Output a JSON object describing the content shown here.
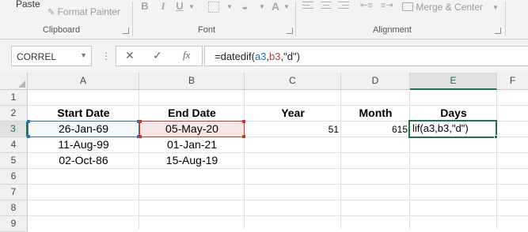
{
  "ribbon": {
    "paste_label": "Paste",
    "format_painter_label": "Format Painter",
    "clipboard_label": "Clipboard",
    "font_label": "Font",
    "alignment_label": "Alignment",
    "merge_center_label": "Merge & Center",
    "bold_label": "B",
    "italic_label": "I",
    "underline_label": "U",
    "font_color_label": "A"
  },
  "formula_bar": {
    "name_box": "CORREL",
    "fx_label": "fx",
    "formula_prefix": "=datedif(",
    "formula_ref1": "a3",
    "formula_sep1": ",",
    "formula_ref2": "b3",
    "formula_suffix": ",\"d\")"
  },
  "grid": {
    "columns": [
      "A",
      "B",
      "C",
      "D",
      "E",
      "F"
    ],
    "rows": [
      "1",
      "2",
      "3",
      "4",
      "5",
      "6",
      "7",
      "8",
      "9"
    ],
    "headers": {
      "start_date": "Start Date",
      "end_date": "End Date",
      "year": "Year",
      "month": "Month",
      "days": "Days"
    },
    "data": [
      {
        "start": "26-Jan-69",
        "end": "05-May-20",
        "year": "51",
        "month": "615",
        "days": "lif(a3,b3,\"d\")"
      },
      {
        "start": "11-Aug-99",
        "end": "01-Jan-21"
      },
      {
        "start": "02-Oct-86",
        "end": "15-Aug-19"
      }
    ]
  },
  "colors": {
    "excel_green": "#217346",
    "ref_blue": "#2e6fc0",
    "ref_red": "#c0392b"
  }
}
